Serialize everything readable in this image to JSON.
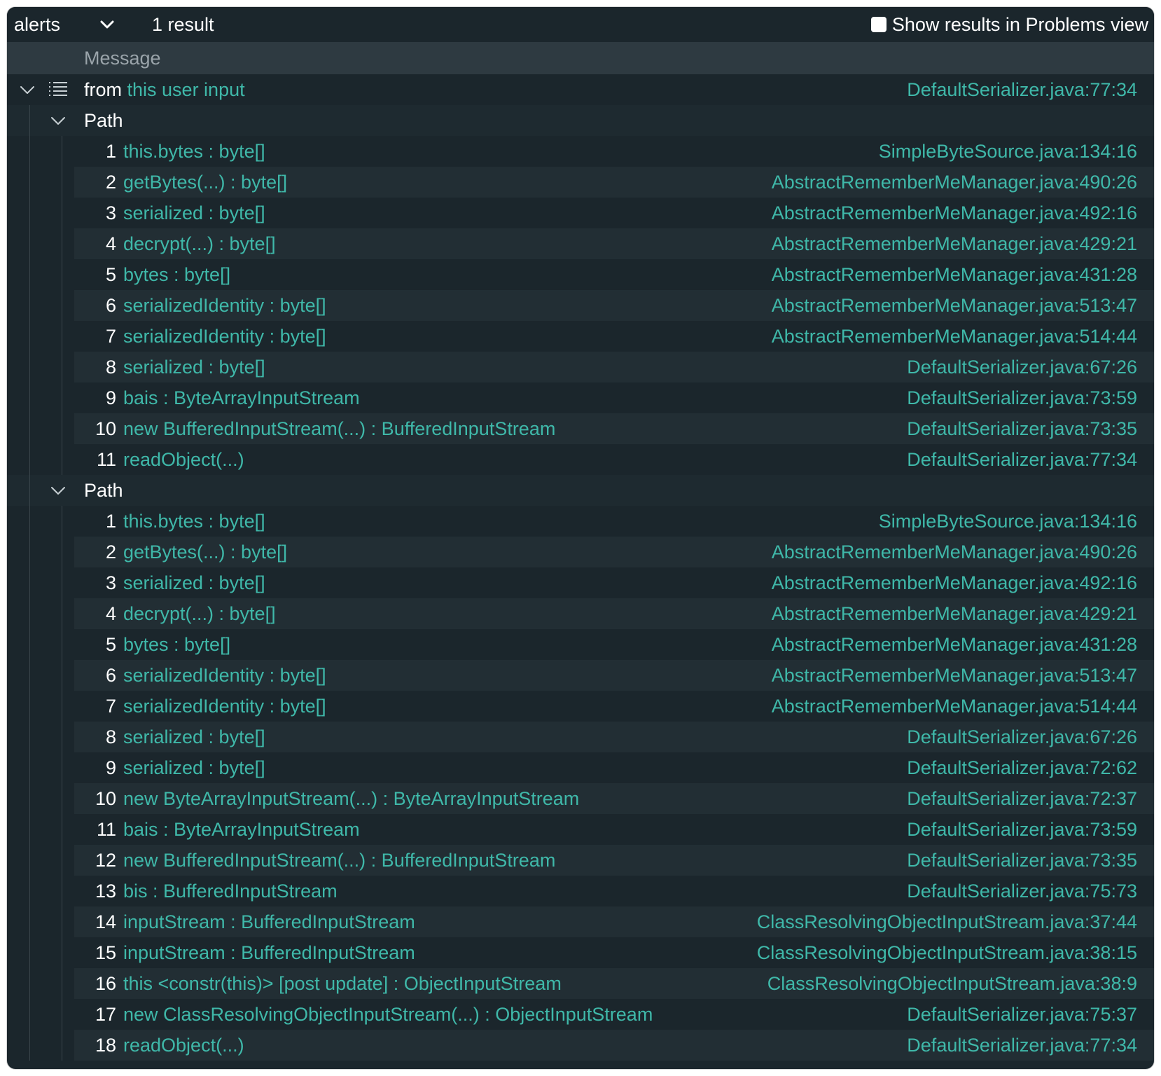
{
  "toolbar": {
    "select_value": "alerts",
    "result_count": "1 result",
    "problems_toggle_label": "Show results in Problems view"
  },
  "table": {
    "header_message": "Message"
  },
  "alert": {
    "prefix": "from",
    "link": "this user input",
    "location": "DefaultSerializer.java:77:34"
  },
  "paths": [
    {
      "label": "Path",
      "steps": [
        {
          "n": "1",
          "text": "this.bytes : byte[]",
          "loc": "SimpleByteSource.java:134:16"
        },
        {
          "n": "2",
          "text": "getBytes(...) : byte[]",
          "loc": "AbstractRememberMeManager.java:490:26"
        },
        {
          "n": "3",
          "text": "serialized : byte[]",
          "loc": "AbstractRememberMeManager.java:492:16"
        },
        {
          "n": "4",
          "text": "decrypt(...) : byte[]",
          "loc": "AbstractRememberMeManager.java:429:21"
        },
        {
          "n": "5",
          "text": "bytes : byte[]",
          "loc": "AbstractRememberMeManager.java:431:28"
        },
        {
          "n": "6",
          "text": "serializedIdentity : byte[]",
          "loc": "AbstractRememberMeManager.java:513:47"
        },
        {
          "n": "7",
          "text": "serializedIdentity : byte[]",
          "loc": "AbstractRememberMeManager.java:514:44"
        },
        {
          "n": "8",
          "text": "serialized : byte[]",
          "loc": "DefaultSerializer.java:67:26"
        },
        {
          "n": "9",
          "text": "bais : ByteArrayInputStream",
          "loc": "DefaultSerializer.java:73:59"
        },
        {
          "n": "10",
          "text": "new BufferedInputStream(...) : BufferedInputStream",
          "loc": "DefaultSerializer.java:73:35"
        },
        {
          "n": "11",
          "text": "readObject(...)",
          "loc": "DefaultSerializer.java:77:34"
        }
      ]
    },
    {
      "label": "Path",
      "steps": [
        {
          "n": "1",
          "text": "this.bytes : byte[]",
          "loc": "SimpleByteSource.java:134:16"
        },
        {
          "n": "2",
          "text": "getBytes(...) : byte[]",
          "loc": "AbstractRememberMeManager.java:490:26"
        },
        {
          "n": "3",
          "text": "serialized : byte[]",
          "loc": "AbstractRememberMeManager.java:492:16"
        },
        {
          "n": "4",
          "text": "decrypt(...) : byte[]",
          "loc": "AbstractRememberMeManager.java:429:21"
        },
        {
          "n": "5",
          "text": "bytes : byte[]",
          "loc": "AbstractRememberMeManager.java:431:28"
        },
        {
          "n": "6",
          "text": "serializedIdentity : byte[]",
          "loc": "AbstractRememberMeManager.java:513:47"
        },
        {
          "n": "7",
          "text": "serializedIdentity : byte[]",
          "loc": "AbstractRememberMeManager.java:514:44"
        },
        {
          "n": "8",
          "text": "serialized : byte[]",
          "loc": "DefaultSerializer.java:67:26"
        },
        {
          "n": "9",
          "text": "serialized : byte[]",
          "loc": "DefaultSerializer.java:72:62"
        },
        {
          "n": "10",
          "text": "new ByteArrayInputStream(...) : ByteArrayInputStream",
          "loc": "DefaultSerializer.java:72:37"
        },
        {
          "n": "11",
          "text": "bais : ByteArrayInputStream",
          "loc": "DefaultSerializer.java:73:59"
        },
        {
          "n": "12",
          "text": "new BufferedInputStream(...) : BufferedInputStream",
          "loc": "DefaultSerializer.java:73:35"
        },
        {
          "n": "13",
          "text": "bis : BufferedInputStream",
          "loc": "DefaultSerializer.java:75:73"
        },
        {
          "n": "14",
          "text": "inputStream : BufferedInputStream",
          "loc": "ClassResolvingObjectInputStream.java:37:44"
        },
        {
          "n": "15",
          "text": "inputStream : BufferedInputStream",
          "loc": "ClassResolvingObjectInputStream.java:38:15"
        },
        {
          "n": "16",
          "text": "this <constr(this)> [post update] : ObjectInputStream",
          "loc": "ClassResolvingObjectInputStream.java:38:9"
        },
        {
          "n": "17",
          "text": "new ClassResolvingObjectInputStream(...) : ObjectInputStream",
          "loc": "DefaultSerializer.java:75:37"
        },
        {
          "n": "18",
          "text": "readObject(...)",
          "loc": "DefaultSerializer.java:77:34"
        }
      ]
    }
  ],
  "icons": {
    "select_chevron": "chevron-down-icon",
    "expand_chevron": "chevron-down-icon",
    "list": "list-icon"
  },
  "colors": {
    "background": "#1b262c",
    "header": "#2e3a41",
    "link": "#3fb8a9",
    "text": "#ffffff",
    "muted": "#9aa4aa"
  }
}
